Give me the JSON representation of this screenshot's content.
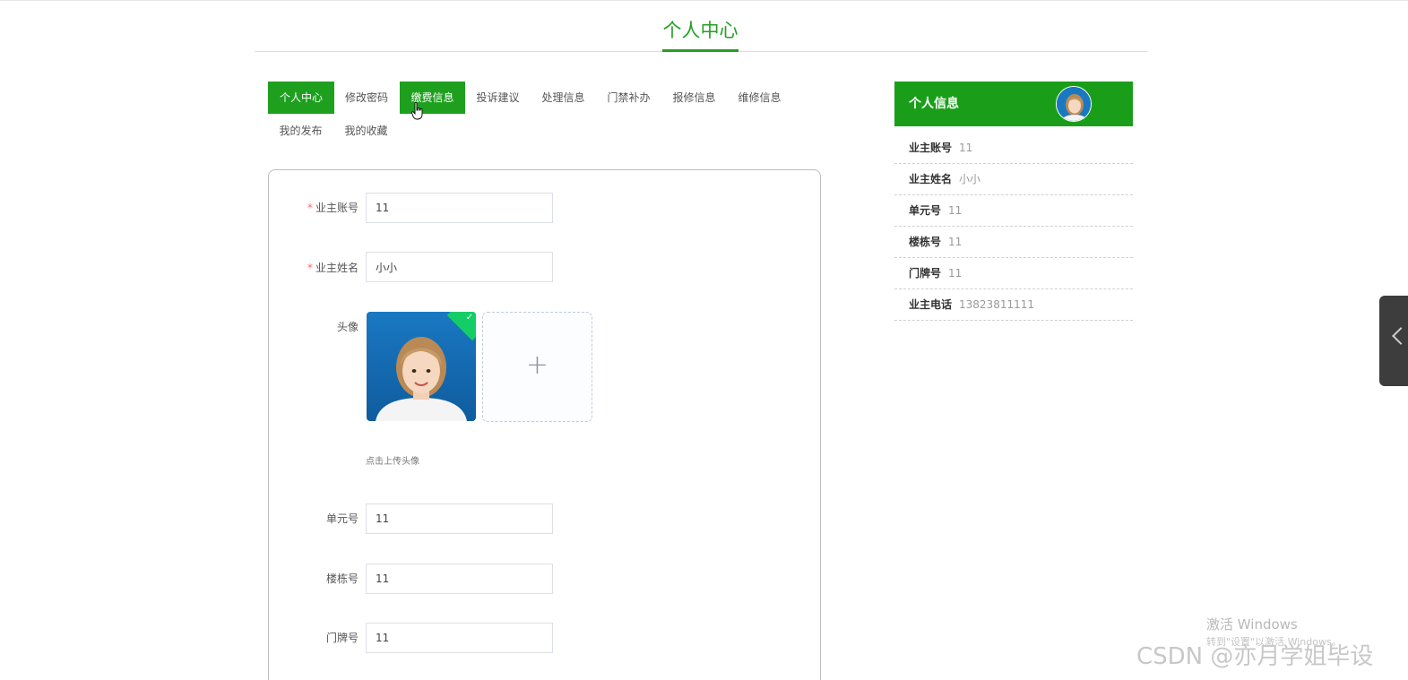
{
  "header": {
    "title": "个人中心"
  },
  "tabs": [
    {
      "label": "个人中心",
      "active": true
    },
    {
      "label": "修改密码",
      "active": false
    },
    {
      "label": "缴费信息",
      "active": true
    },
    {
      "label": "投诉建议",
      "active": false
    },
    {
      "label": "处理信息",
      "active": false
    },
    {
      "label": "门禁补办",
      "active": false
    },
    {
      "label": "报修信息",
      "active": false
    },
    {
      "label": "维修信息",
      "active": false
    },
    {
      "label": "我的发布",
      "active": false
    },
    {
      "label": "我的收藏",
      "active": false
    }
  ],
  "form": {
    "account_label": "业主账号",
    "account_value": "11",
    "name_label": "业主姓名",
    "name_value": "小小",
    "avatar_label": "头像",
    "upload_tip": "点击上传头像",
    "unit_label": "单元号",
    "unit_value": "11",
    "building_label": "楼栋号",
    "building_value": "11",
    "door_label": "门牌号",
    "door_value": "11",
    "required_mark": "*"
  },
  "sidebar": {
    "title": "个人信息",
    "rows": [
      {
        "key": "业主账号",
        "value": "11"
      },
      {
        "key": "业主姓名",
        "value": "小小"
      },
      {
        "key": "单元号",
        "value": "11"
      },
      {
        "key": "楼栋号",
        "value": "11"
      },
      {
        "key": "门牌号",
        "value": "11"
      },
      {
        "key": "业主电话",
        "value": "13823811111"
      }
    ]
  },
  "watermark": {
    "activate_title": "激活 Windows",
    "activate_sub": "转到\"设置\"以激活 Windows。",
    "csdn": "CSDN @亦月学姐毕设"
  },
  "colors": {
    "brand": "#1ea01e",
    "required": "#f56c6c",
    "upload_success": "#13ce66"
  },
  "icons": {
    "upload": "plus-icon",
    "success": "check-icon",
    "float": "chevron-left-icon",
    "cursor": "hand-pointer-icon"
  }
}
